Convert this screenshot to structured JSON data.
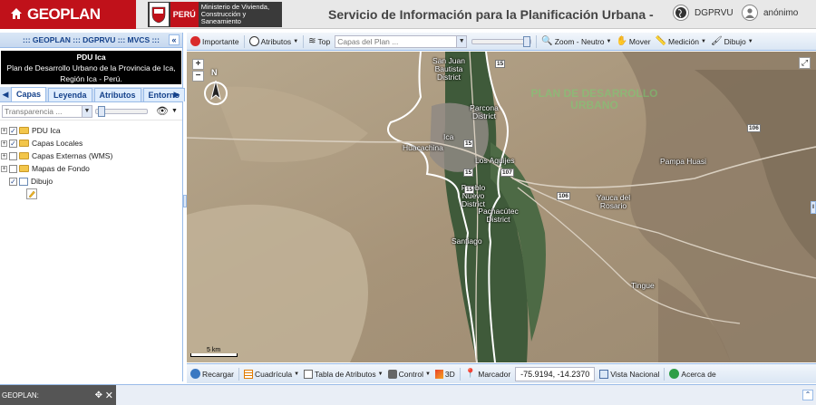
{
  "header": {
    "brand": "GEOPLAN",
    "country": "PERÚ",
    "ministry": "Ministerio de Vivienda, Construcción y Saneamiento",
    "title": "Servicio de Información para la Planificación Urbana -",
    "org": "DGPRVU",
    "user": "anónimo"
  },
  "left_panel": {
    "title": "::: GEOPLAN ::: DGPRVU ::: MVCS :::",
    "plan_title": "PDU Ica",
    "plan_desc": "Plan de Desarrollo Urbano de la Provincia de Ica, Región Ica - Perú.",
    "tabs": [
      "Capas",
      "Leyenda",
      "Atributos",
      "Entorno"
    ],
    "transparency_placeholder": "Transparencia ...",
    "tree": [
      {
        "label": "PDU Ica",
        "type": "folder",
        "checked": true
      },
      {
        "label": "Capas Locales",
        "type": "folder",
        "checked": true
      },
      {
        "label": "Capas Externas (WMS)",
        "type": "folder",
        "checked": false
      },
      {
        "label": "Mapas de Fondo",
        "type": "folder",
        "checked": false
      },
      {
        "label": "Dibujo",
        "type": "layer",
        "checked": true
      }
    ]
  },
  "map_toolbar": {
    "importante": "Importante",
    "atributos": "Atributos",
    "top": "Top",
    "layer_placeholder": "Capas del Plan ...",
    "zoom": "Zoom - Neutro",
    "mover": "Mover",
    "medicion": "Medición",
    "dibujo": "Dibujo"
  },
  "map": {
    "labels": {
      "san_juan": "San Juan Bautista District",
      "parcona": "Parcona District",
      "ica": "Ica",
      "huacachina": "Huacachina",
      "los_aquijes": "Los Aquijes",
      "pueblo_nuevo": "Pueblo Nuevo District",
      "pachacutec": "Pachacútec District",
      "santiago": "Santiago",
      "pampa_huasi": "Pampa Huasi",
      "yauca": "Yauca del Rosario",
      "tingue": "Tingue"
    },
    "road_shields": [
      "15",
      "15",
      "15",
      "107",
      "15",
      "106",
      "106"
    ],
    "watermark": "PLAN DE DESARROLLO URBANO",
    "scale": "5 km",
    "north": "N"
  },
  "bottom_toolbar": {
    "recargar": "Recargar",
    "cuadricula": "Cuadrícula",
    "tabla": "Tabla de Atributos",
    "control": "Control",
    "tres_d": "3D",
    "marcador": "Marcador",
    "coords": "-75.9194, -14.2370",
    "vista": "Vista Nacional",
    "acerca": "Acerca de"
  },
  "status": {
    "label": "GEOPLAN:"
  }
}
